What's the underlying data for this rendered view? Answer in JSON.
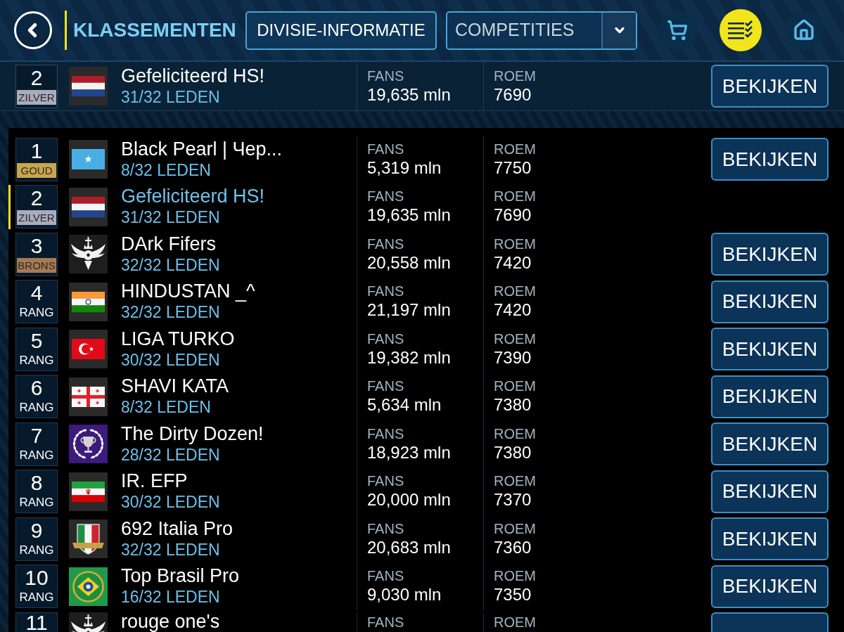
{
  "header": {
    "title": "KLASSEMENTEN",
    "tab": {
      "label": "DIVISIE-INFORMATIE"
    },
    "dropdown": {
      "value": "COMPETITIES"
    }
  },
  "pinned": {
    "rank": "2",
    "badge": {
      "text": "ZILVER",
      "color": "#a9abbf"
    },
    "emblem": {
      "kind": "netherlands"
    },
    "name": "Gefeliciteerd HS!",
    "members": "31/32 LEDEN",
    "fans_label": "FANS",
    "fans": "19,635 mln",
    "roem_label": "ROEM",
    "roem": "7690",
    "action": "BEKIJKEN"
  },
  "rows": [
    {
      "rank": "1",
      "badge": {
        "text": "GOUD",
        "color": "#c9a54f"
      },
      "emblem": {
        "kind": "somalia"
      },
      "name": "Black Pearl | Чер...",
      "members": "8/32 LEDEN",
      "fans_label": "FANS",
      "fans": "5,319 mln",
      "roem_label": "ROEM",
      "roem": "7750",
      "action": "BEKIJKEN",
      "selected": false
    },
    {
      "rank": "2",
      "badge": {
        "text": "ZILVER",
        "color": "#a9abbf"
      },
      "emblem": {
        "kind": "netherlands"
      },
      "name": "Gefeliciteerd HS!",
      "members": "31/32 LEDEN",
      "fans_label": "FANS",
      "fans": "19,635 mln",
      "roem_label": "ROEM",
      "roem": "7690",
      "selected": true
    },
    {
      "rank": "3",
      "badge": {
        "text": "BRONS",
        "color": "#a57a55"
      },
      "emblem": {
        "kind": "wings"
      },
      "name": "DArk Fifers",
      "members": "32/32 LEDEN",
      "fans_label": "FANS",
      "fans": "20,558 mln",
      "roem_label": "ROEM",
      "roem": "7420",
      "action": "BEKIJKEN",
      "selected": false
    },
    {
      "rank": "4",
      "badge": {
        "text": "RANG"
      },
      "emblem": {
        "kind": "india"
      },
      "name": "HINDUSTAN _^",
      "members": "32/32 LEDEN",
      "fans_label": "FANS",
      "fans": "21,197 mln",
      "roem_label": "ROEM",
      "roem": "7420",
      "action": "BEKIJKEN",
      "selected": false
    },
    {
      "rank": "5",
      "badge": {
        "text": "RANG"
      },
      "emblem": {
        "kind": "turkey"
      },
      "name": "LIGA TURKO",
      "members": "30/32 LEDEN",
      "fans_label": "FANS",
      "fans": "19,382 mln",
      "roem_label": "ROEM",
      "roem": "7390",
      "action": "BEKIJKEN",
      "selected": false
    },
    {
      "rank": "6",
      "badge": {
        "text": "RANG"
      },
      "emblem": {
        "kind": "georgia"
      },
      "name": "SHAVI KATA",
      "members": "8/32 LEDEN",
      "fans_label": "FANS",
      "fans": "5,634 mln",
      "roem_label": "ROEM",
      "roem": "7380",
      "action": "BEKIJKEN",
      "selected": false
    },
    {
      "rank": "7",
      "badge": {
        "text": "RANG"
      },
      "emblem": {
        "kind": "wreath"
      },
      "name": "The Dirty Dozen!",
      "members": "28/32 LEDEN",
      "fans_label": "FANS",
      "fans": "18,923 mln",
      "roem_label": "ROEM",
      "roem": "7380",
      "action": "BEKIJKEN",
      "selected": false
    },
    {
      "rank": "8",
      "badge": {
        "text": "RANG"
      },
      "emblem": {
        "kind": "iran"
      },
      "name": "IR. EFP",
      "members": "30/32 LEDEN",
      "fans_label": "FANS",
      "fans": "20,000 mln",
      "roem_label": "ROEM",
      "roem": "7370",
      "action": "BEKIJKEN",
      "selected": false
    },
    {
      "rank": "9",
      "badge": {
        "text": "RANG"
      },
      "emblem": {
        "kind": "shield"
      },
      "name": "692 Italia Pro",
      "members": "32/32 LEDEN",
      "fans_label": "FANS",
      "fans": "20,683 mln",
      "roem_label": "ROEM",
      "roem": "7360",
      "action": "BEKIJKEN",
      "selected": false
    },
    {
      "rank": "10",
      "badge": {
        "text": "RANG"
      },
      "emblem": {
        "kind": "brazil"
      },
      "name": "Top Brasil Pro",
      "members": "16/32 LEDEN",
      "fans_label": "FANS",
      "fans": "9,030 mln",
      "roem_label": "ROEM",
      "roem": "7350",
      "action": "BEKIJKEN",
      "selected": false
    },
    {
      "rank": "11",
      "emblem": {
        "kind": "wings"
      },
      "name": "rouge one's",
      "fans_label": "FANS",
      "roem_label": "ROEM",
      "action_stub": true,
      "selected": false
    }
  ]
}
